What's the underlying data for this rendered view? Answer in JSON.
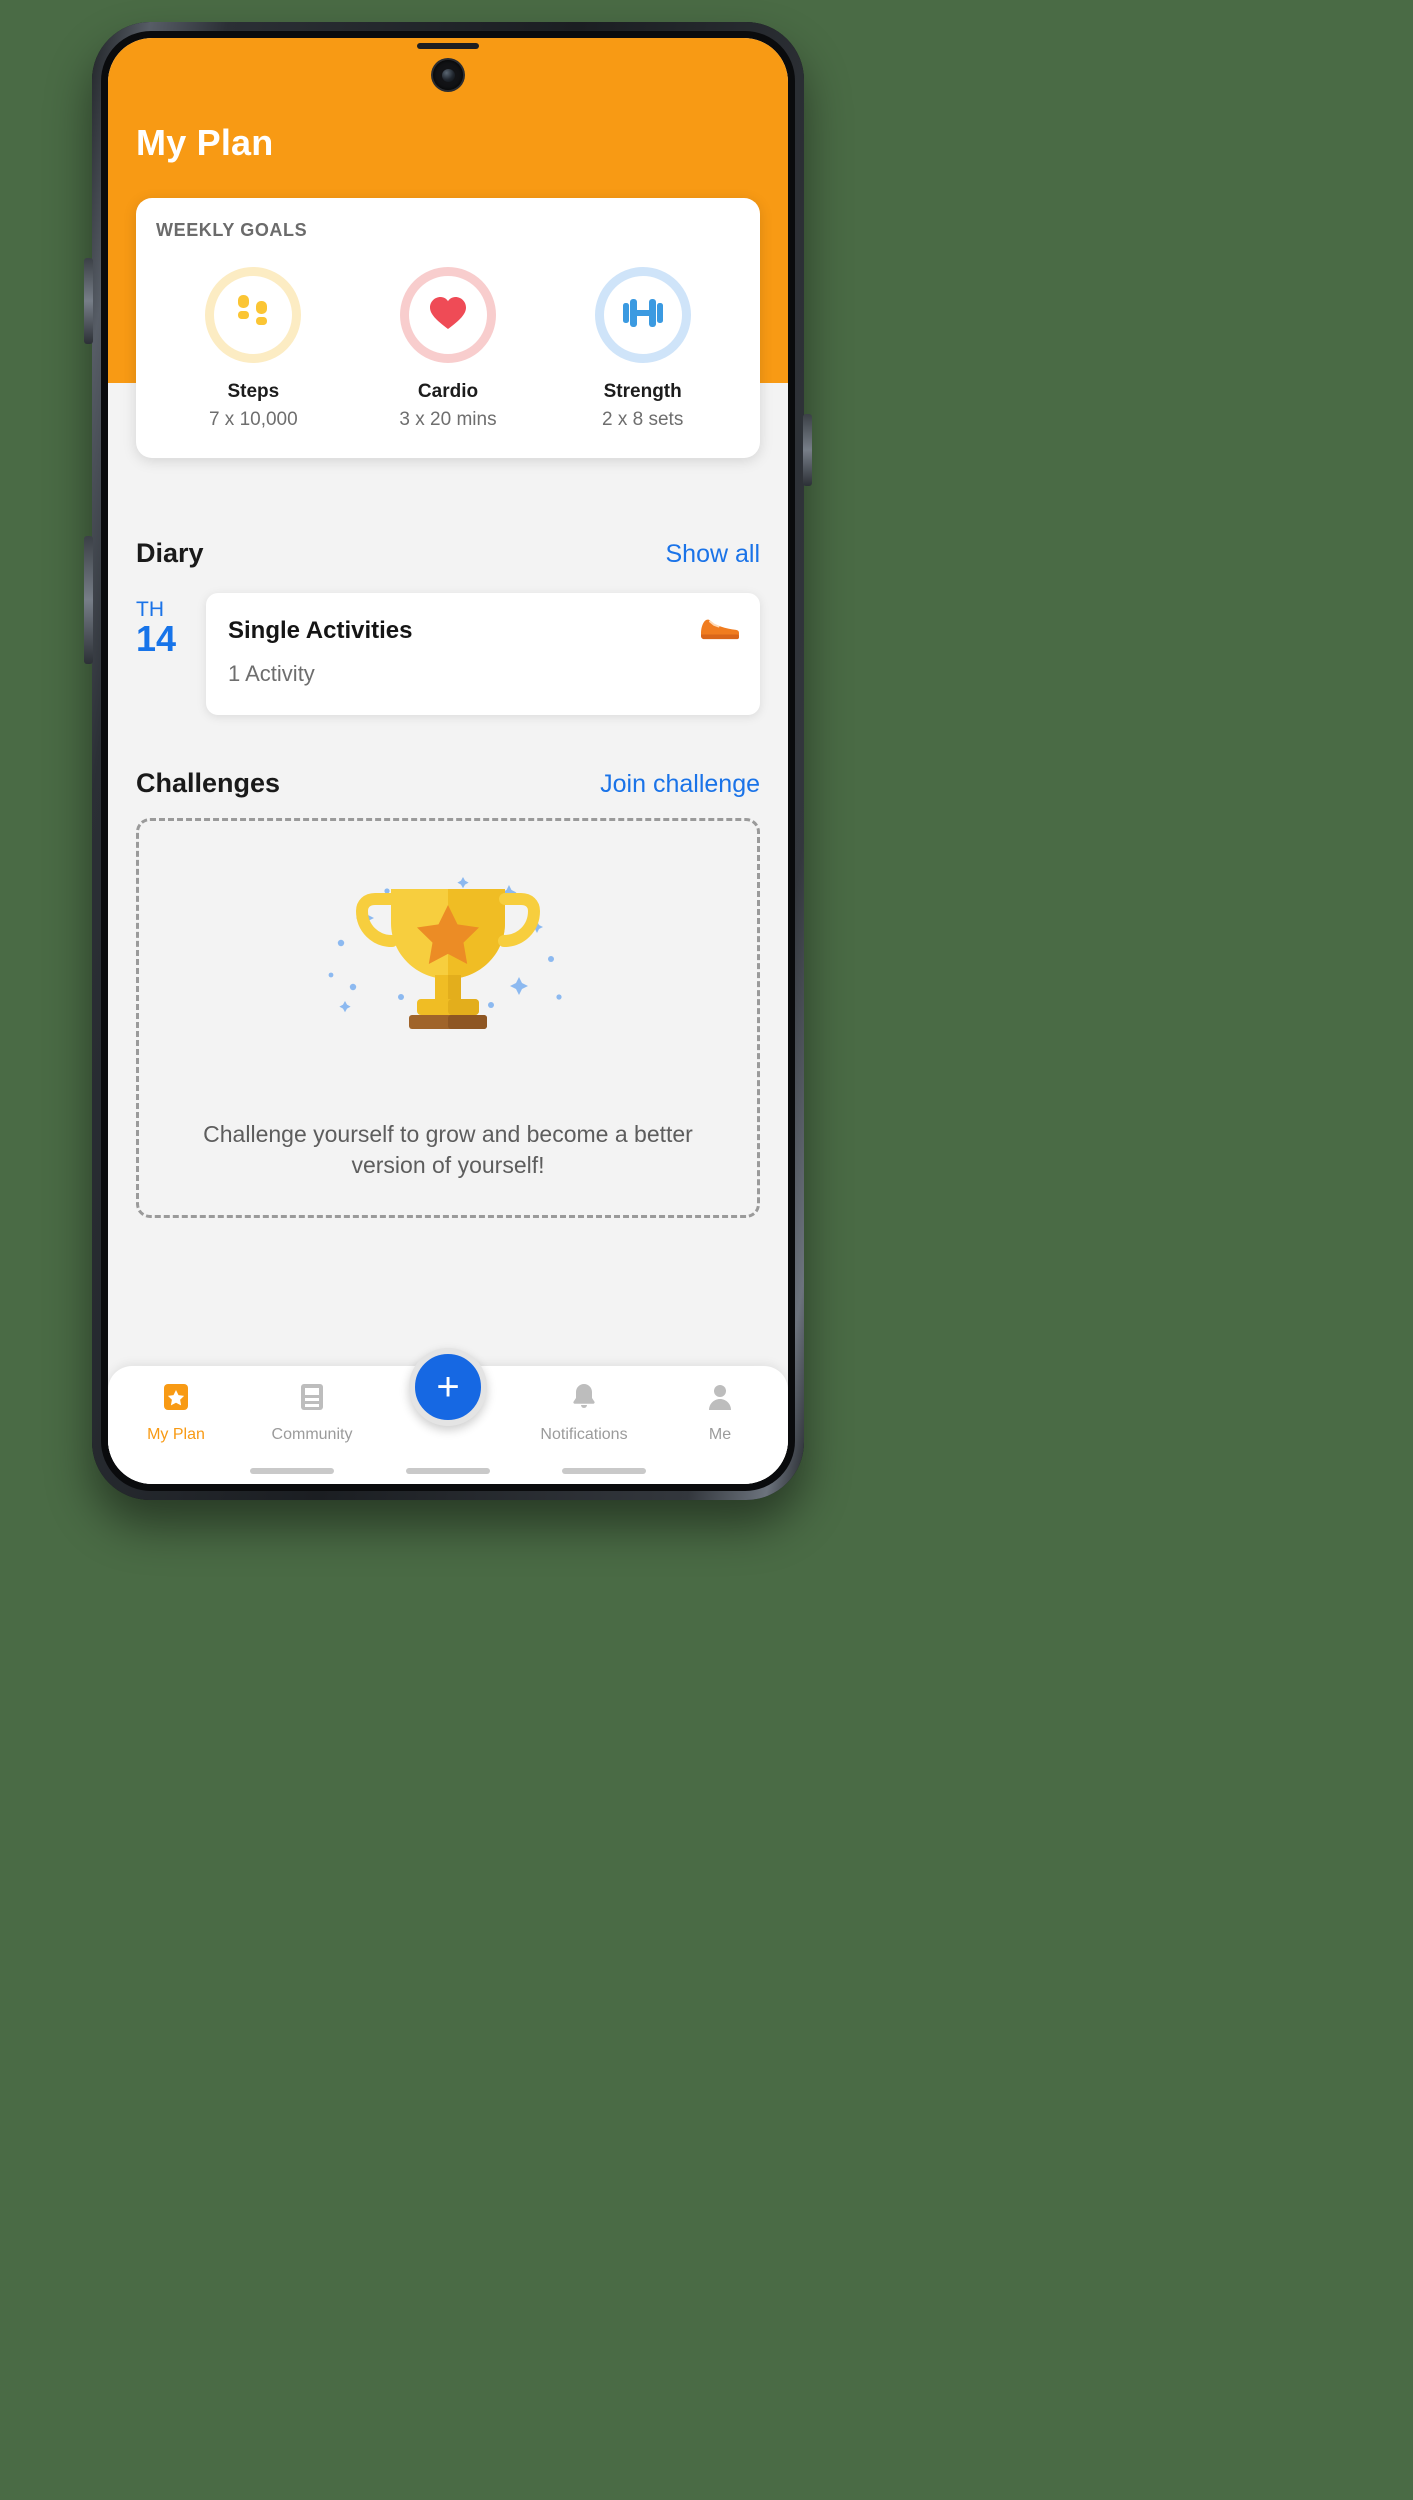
{
  "header": {
    "title": "My Plan"
  },
  "weekly_goals": {
    "section_title": "WEEKLY GOALS",
    "items": [
      {
        "icon": "footprints-icon",
        "label": "Steps",
        "value": "7 x 10,000",
        "ring_color": "#fcecc3",
        "accent": "#fbc534"
      },
      {
        "icon": "heart-icon",
        "label": "Cardio",
        "value": "3 x 20 mins",
        "ring_color": "#f8cdcd",
        "accent": "#ef4b56"
      },
      {
        "icon": "dumbbell-icon",
        "label": "Strength",
        "value": "2 x 8 sets",
        "ring_color": "#cfe4f9",
        "accent": "#3b9ae1"
      }
    ]
  },
  "diary": {
    "title": "Diary",
    "link": "Show all",
    "entry": {
      "day_of_week": "TH",
      "day_number": "14",
      "card_title": "Single Activities",
      "card_subtitle": "1 Activity",
      "icon": "sneaker-icon"
    }
  },
  "challenges": {
    "title": "Challenges",
    "link": "Join challenge",
    "illustration": "trophy-icon",
    "empty_text": "Challenge yourself to grow and become a better version of yourself!"
  },
  "bottom_nav": {
    "items": [
      {
        "label": "My Plan",
        "icon": "star-badge-icon",
        "active": true
      },
      {
        "label": "Community",
        "icon": "feed-icon",
        "active": false
      },
      {
        "label": "Notifications",
        "icon": "bell-icon",
        "active": false
      },
      {
        "label": "Me",
        "icon": "person-icon",
        "active": false
      }
    ],
    "fab": {
      "label": "+",
      "icon": "plus-icon",
      "color": "#1668e3"
    }
  },
  "colors": {
    "header_orange": "#f89a14",
    "accent_blue": "#1a73e8",
    "page_bg": "#f3f3f3"
  }
}
